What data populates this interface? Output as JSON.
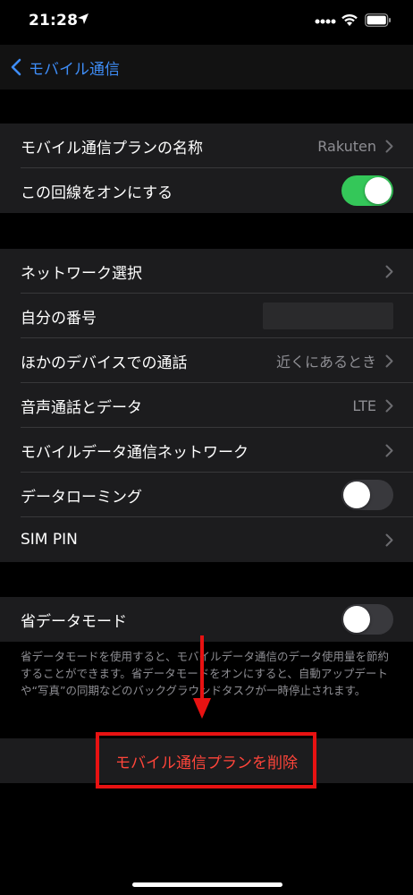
{
  "status": {
    "time": "21:28"
  },
  "nav": {
    "back_label": "モバイル通信"
  },
  "group1": {
    "plan_name_label": "モバイル通信プランの名称",
    "plan_name_value": "Rakuten",
    "line_on_label": "この回線をオンにする"
  },
  "group2": {
    "network_select_label": "ネットワーク選択",
    "my_number_label": "自分の番号",
    "other_devices_label": "ほかのデバイスでの通話",
    "other_devices_value": "近くにあるとき",
    "voice_data_label": "音声通話とデータ",
    "voice_data_value": "LTE",
    "mobile_data_network_label": "モバイルデータ通信ネットワーク",
    "data_roaming_label": "データローミング",
    "sim_pin_label": "SIM PIN"
  },
  "group3": {
    "low_data_mode_label": "省データモード",
    "footer_note": "省データモードを使用すると、モバイルデータ通信のデータ使用量を節約することができます。省データモードをオンにすると、自動アップデートや“写真”の同期などのバックグラウンドタスクが一時停止されます。"
  },
  "delete": {
    "label": "モバイル通信プランを削除"
  },
  "toggles": {
    "line_on": true,
    "data_roaming": false,
    "low_data_mode": false
  },
  "colors": {
    "accent": "#3e8df7",
    "toggle_on": "#34c759",
    "destructive": "#ff453a",
    "annotation": "#e81212"
  },
  "icons": {
    "location": "location-arrow-icon",
    "signal": "cellular-signal-icon",
    "wifi": "wifi-icon",
    "battery": "battery-icon",
    "back": "chevron-left-icon",
    "disclosure": "chevron-right-icon"
  }
}
